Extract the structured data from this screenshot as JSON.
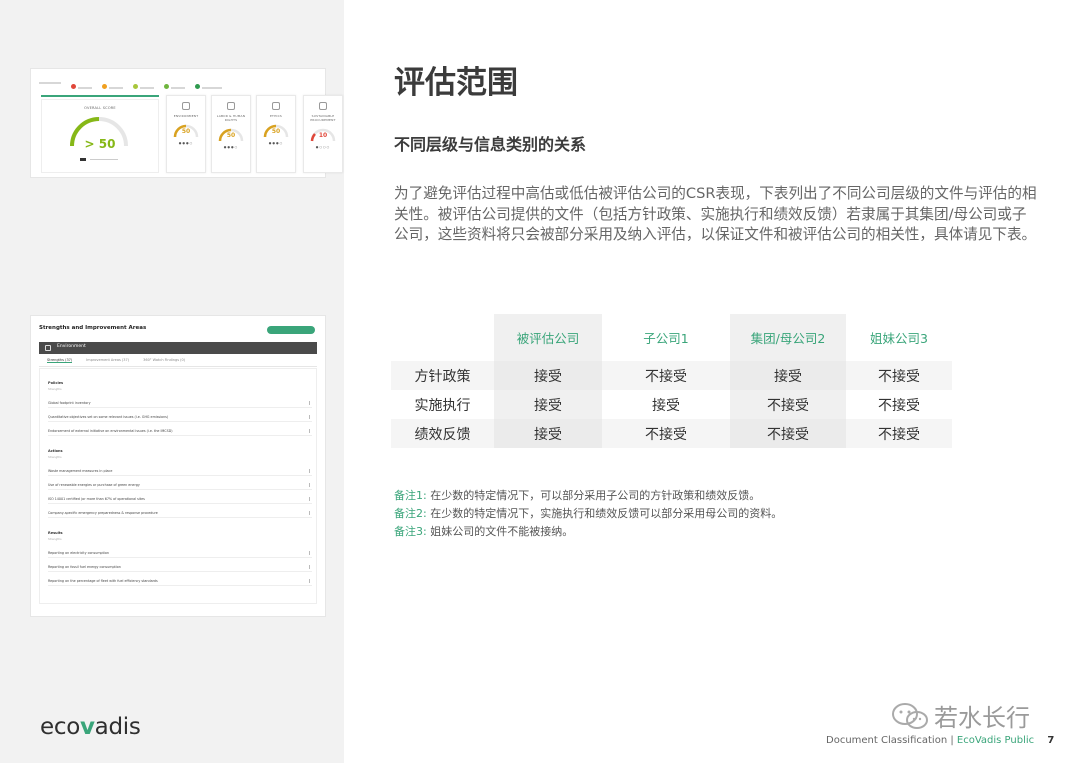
{
  "page": {
    "title": "评估范围",
    "subtitle": "不同层级与信息类别的关系",
    "paragraph": "为了避免评估过程中高估或低估被评估公司的CSR表现，下表列出了不同公司层级的文件与评估的相关性。被评估公司提供的文件（包括方针政策、实施执行和绩效反馈）若隶属于其集团/母公司或子公司，这些资料将只会被部分采用及纳入评估，以保证文件和被评估公司的相关性，具体请见下表。"
  },
  "table": {
    "columns": [
      "被评估公司",
      "子公司1",
      "集团/母公司2",
      "姐妹公司3"
    ],
    "rows": [
      {
        "label": "方针政策",
        "cells": [
          "接受",
          "不接受",
          "接受",
          "不接受"
        ]
      },
      {
        "label": "实施执行",
        "cells": [
          "接受",
          "接受",
          "不接受",
          "不接受"
        ]
      },
      {
        "label": "绩效反馈",
        "cells": [
          "接受",
          "不接受",
          "不接受",
          "不接受"
        ]
      }
    ]
  },
  "notes": [
    {
      "tag": "备注1:",
      "text": "在少数的特定情况下，可以部分采用子公司的方针政策和绩效反馈。"
    },
    {
      "tag": "备注2:",
      "text": "在少数的特定情况下，实施执行和绩效反馈可以部分采用母公司的资料。"
    },
    {
      "tag": "备注3:",
      "text": "姐妹公司的文件不能被接纳。"
    }
  ],
  "dashboard": {
    "overall_label": "OVERALL SCORE",
    "overall_score": "50",
    "themes": [
      {
        "label": "ENVIRONMENT",
        "score": "50"
      },
      {
        "label": "LABOR & HUMAN RIGHTS",
        "score": "50"
      },
      {
        "label": "ETHICS",
        "score": "50"
      },
      {
        "label": "SUSTAINABLE PROCUREMENT",
        "score": "10"
      }
    ]
  },
  "strengths": {
    "title": "Strengths and Improvement Areas",
    "header": "Environment",
    "tabs": [
      "Strengths (37)",
      "Improvement Areas (37)",
      "360° Watch Findings (0)"
    ],
    "sections": [
      {
        "name": "Policies",
        "items": [
          "Global footprint inventory",
          "Quantitative objectives set on some relevant issues (i.e. GHG emissions)",
          "Endorsement of external initiative on environmental issues (i.e. the IMCSD)"
        ]
      },
      {
        "name": "Actions",
        "items": [
          "Waste management measures in place",
          "Use of renewable energies or purchase of green energy",
          "ISO 14001 certified (or more than 67% of operational sites",
          "Company-specific emergency preparedness & response procedure"
        ]
      },
      {
        "name": "Results",
        "items": [
          "Reporting on electricity consumption",
          "Reporting on fossil fuel energy consumption",
          "Reporting on the percentage of fleet with fuel efficiency standards"
        ]
      }
    ],
    "section_sub": "Strengths"
  },
  "logo": {
    "eco": "eco",
    "v": "v",
    "adis": "adis"
  },
  "watermark": "若水长行",
  "footer": {
    "classification": "Document Classification |",
    "public": "EcoVadis Public",
    "page": "7"
  },
  "colors": {
    "accent": "#3aa57a",
    "gauge_green": "#86b817",
    "gauge_orange": "#d9a220"
  }
}
